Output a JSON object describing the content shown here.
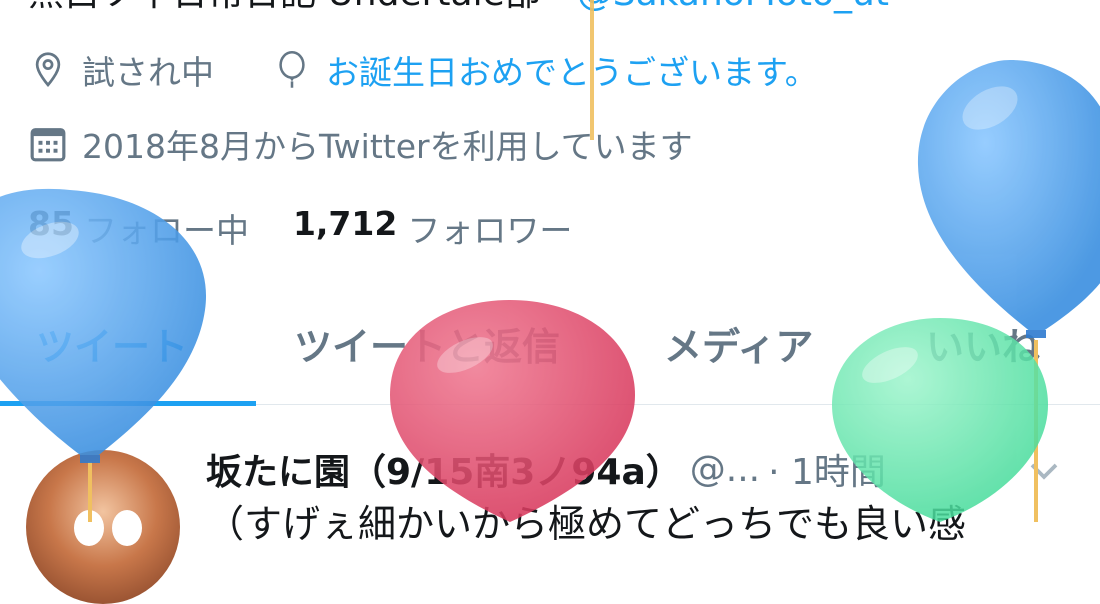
{
  "profile": {
    "bio_partial": "黒白ソ不日常日記 Undertale部・",
    "bio_link": "@SakanoMoto_ut",
    "location": "試され中",
    "birthday_text": "お誕生日おめでとうございます。",
    "joined": "2018年8月からTwitterを利用しています",
    "following_count": "85",
    "following_label": "フォロー中",
    "followers_count": "1,712",
    "followers_label": "フォロワー"
  },
  "tabs": [
    {
      "label": "ツイート"
    },
    {
      "label": "ツイートと返信"
    },
    {
      "label": "メディア"
    },
    {
      "label": "いいね"
    }
  ],
  "tweet": {
    "name": "坂たに園（9/15南3ノ94a）",
    "handle": "@...",
    "time": "· 1時間",
    "body": "（すげぇ細かいから極めてどっちでも良い感"
  },
  "colors": {
    "accent": "#1da1f2",
    "secondary_text": "#657786",
    "balloon_blue": "#4a9eea",
    "balloon_red": "#e04a6a",
    "balloon_green": "#5ee6a8",
    "string": "#f0c060"
  }
}
